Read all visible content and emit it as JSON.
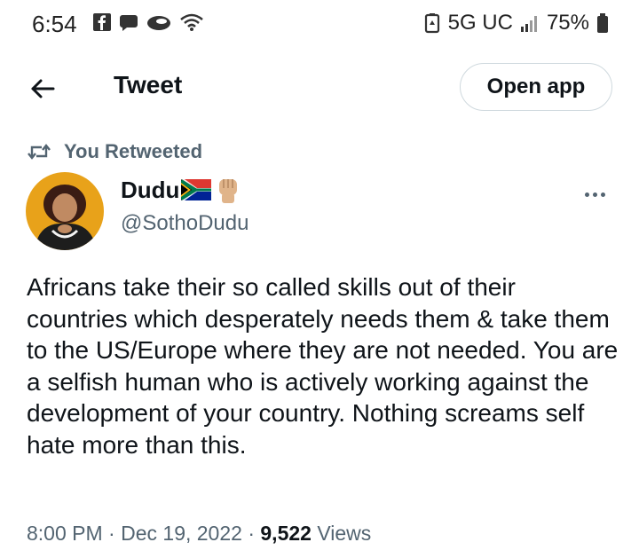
{
  "status_bar": {
    "time": "6:54",
    "network": "5G UC",
    "battery": "75%",
    "left_icons": [
      "facebook-icon",
      "bubble-icon",
      "cloud-icon",
      "wifi-icon"
    ],
    "right_icons": [
      "data-saver-icon",
      "signal-icon",
      "battery-icon"
    ]
  },
  "header": {
    "title": "Tweet",
    "open_app_label": "Open app",
    "back_icon": "arrow-left-icon"
  },
  "tweet": {
    "retweet_label": "You Retweeted",
    "author_name": "Dudu",
    "author_name_emojis": [
      "south-africa-flag-icon",
      "raised-fist-icon"
    ],
    "author_handle": "@SothoDudu",
    "text": "Africans take their so called skills out of their countries which desperately needs them & take them to the US/Europe where they are not needed. You are a selfish human who is actively working against the development of your country. Nothing screams self hate more than this.",
    "time": "8:00 PM",
    "date": "Dec 19, 2022",
    "views_count": "9,522",
    "views_label": "Views",
    "separator": "·"
  },
  "colors": {
    "text_primary": "#0f1419",
    "text_secondary": "#536471",
    "border": "#cfd9de",
    "background": "#ffffff"
  }
}
